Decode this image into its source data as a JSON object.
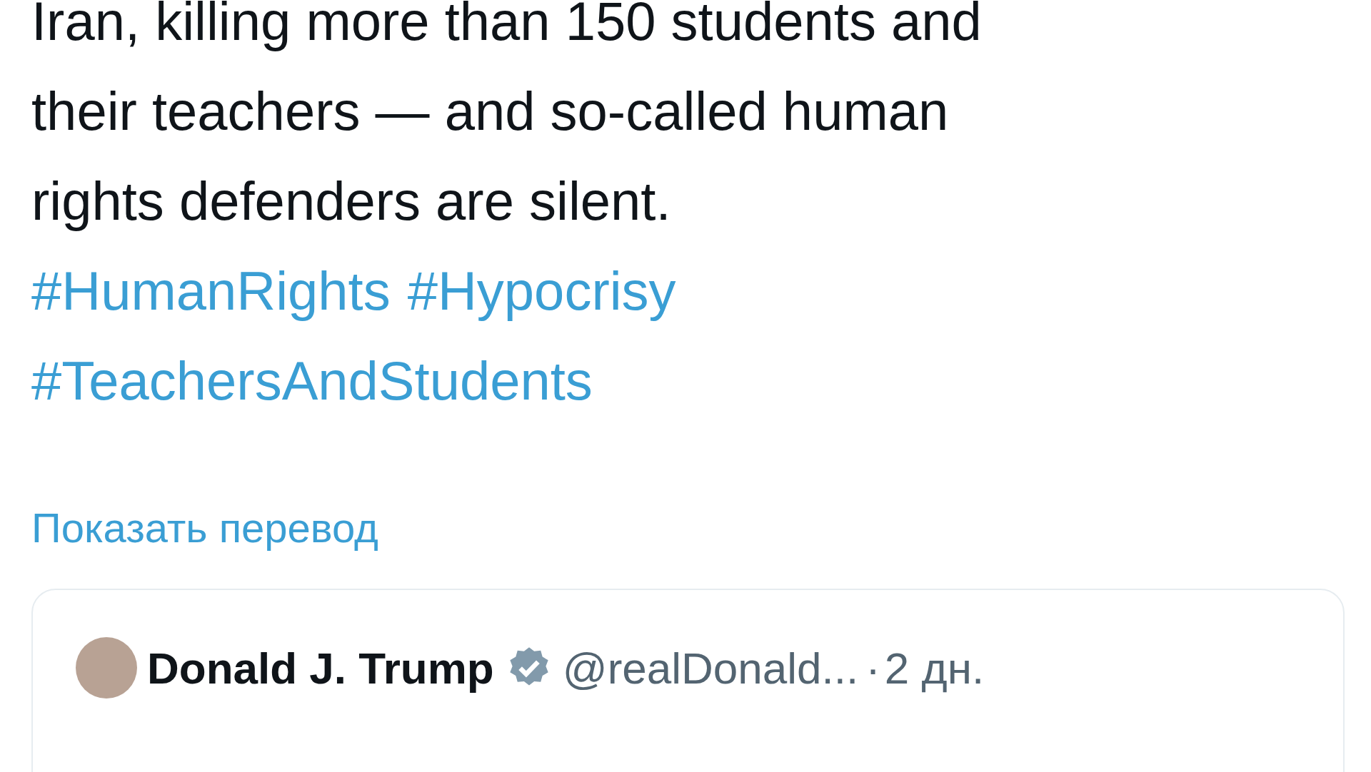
{
  "post": {
    "text": "Iran, killing more than 150 students and\ntheir teachers — and so-called human\nrights defenders are silent.",
    "hashtags": [
      "#HumanRights",
      "#Hypocrisy",
      "#TeachersAndStudents"
    ],
    "translate_link": "Показать перевод"
  },
  "quoted_post": {
    "author": "Donald J. Trump",
    "verified": true,
    "handle": "@realDonald...",
    "separator": "·",
    "time": "2 дн."
  }
}
